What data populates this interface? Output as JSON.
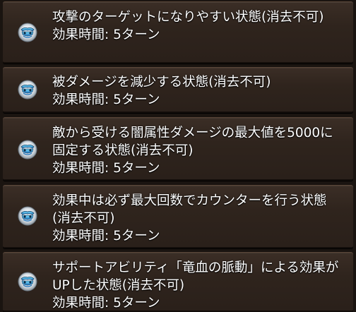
{
  "status_effects": [
    {
      "icon": "shield-buff-icon",
      "description": "攻撃のターゲットになりやすい状態(消去不可)",
      "duration": "効果時間: 5ターン"
    },
    {
      "icon": "shield-buff-icon",
      "description": "被ダメージを減少する状態(消去不可)",
      "duration": "効果時間: 5ターン"
    },
    {
      "icon": "shield-buff-icon",
      "description": "敵から受ける闇属性ダメージの最大値を5000に固定する状態(消去不可)",
      "duration": "効果時間: 5ターン"
    },
    {
      "icon": "shield-buff-icon",
      "description": "効果中は必ず最大回数でカウンターを行う状態(消去不可)",
      "duration": "効果時間: 5ターン"
    },
    {
      "icon": "shield-buff-icon",
      "description": "サポートアビリティ「竜血の脈動」による効果がUPした状態(消去不可)",
      "duration": "効果時間: 5ターン"
    }
  ],
  "colors": {
    "panel_bg": "#2f241d",
    "text": "#ffffff",
    "icon_blue": "#3ab4e8"
  }
}
